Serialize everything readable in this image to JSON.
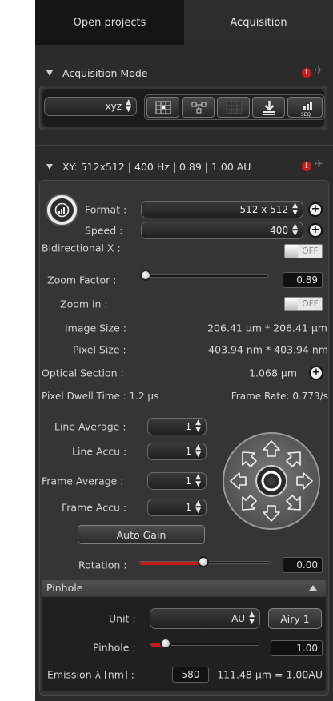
{
  "tabs": {
    "open_projects": "Open projects",
    "acquisition": "Acquisition"
  },
  "acq_mode": {
    "title": "Acquisition Mode",
    "mode_value": "xyz",
    "buttons": [
      "tile-scan-icon",
      "positions-icon",
      "grid-icon",
      "download-icon",
      "seq-icon"
    ],
    "seq_label": "SEQ"
  },
  "xy": {
    "title": "XY: 512x512 | 400 Hz | 0.89 | 1.00 AU",
    "format_label": "Format :",
    "format_value": "512 x 512",
    "speed_label": "Speed :",
    "speed_value": "400",
    "bidir_label": "Bidirectional X :",
    "bidir_state": "OFF",
    "zoom_label": "Zoom Factor :",
    "zoom_value": "0.89",
    "zoomin_label": "Zoom in :",
    "zoomin_state": "OFF",
    "image_size_label": "Image Size :",
    "image_size_value": "206.41 µm * 206.41 µm",
    "pixel_size_label": "Pixel Size :",
    "pixel_size_value": "403.94 nm * 403.94 nm",
    "optical_label": "Optical Section :",
    "optical_value": "1.068 µm",
    "dwell": "Pixel Dwell Time : 1.2 µs",
    "frame_rate": "Frame Rate: 0.773/s",
    "line_avg_label": "Line Average :",
    "line_avg_value": "1",
    "line_accu_label": "Line Accu :",
    "line_accu_value": "1",
    "frame_avg_label": "Frame Average :",
    "frame_avg_value": "1",
    "frame_accu_label": "Frame Accu :",
    "frame_accu_value": "1",
    "auto_gain": "Auto Gain",
    "rotation_label": "Rotation :",
    "rotation_value": "0.00",
    "accent": "#c81a1a"
  },
  "pinhole": {
    "header": "Pinhole",
    "unit_label": "Unit :",
    "unit_value": "AU",
    "airy_button": "Airy 1",
    "pinhole_label": "Pinhole :",
    "pinhole_value": "1.00",
    "emission_label": "Emission λ [nm] :",
    "emission_value": "580",
    "pinhole_size": "111.48 µm = 1.00AU"
  }
}
